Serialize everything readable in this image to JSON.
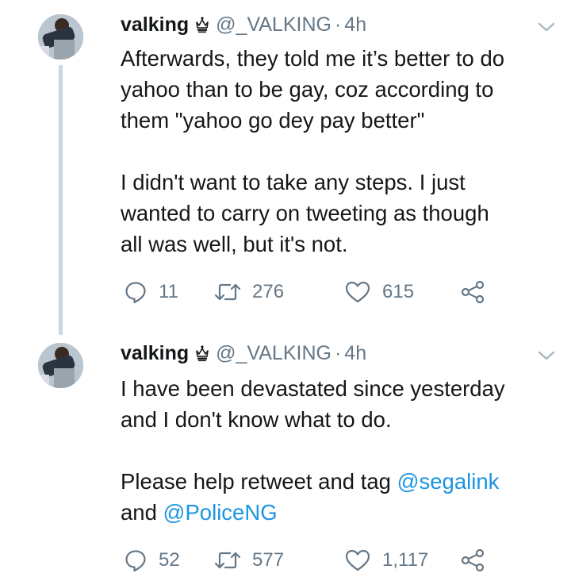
{
  "tweets": [
    {
      "author_name": "valking",
      "verified_badge_icon": "crown-icon",
      "handle": "@_VALKING",
      "separator": "·",
      "time": "4h",
      "lines": [
        "Afterwards, they told me it’s better to do",
        "yahoo than to be gay, coz according to",
        "them \"yahoo go dey pay better\"",
        "",
        "I didn't want to take any steps. I just",
        "wanted to carry on tweeting as though",
        "all was well, but it's not."
      ],
      "replies": "11",
      "retweets": "276",
      "likes": "615"
    },
    {
      "author_name": "valking",
      "verified_badge_icon": "crown-icon",
      "handle": "@_VALKING",
      "separator": "·",
      "time": "4h",
      "line1": "I have been devastated since yesterday",
      "line2": "and I don't know what to do.",
      "line4_prefix": "Please help retweet and tag ",
      "mention1": "@segalink",
      "line5_prefix": "and ",
      "mention2": "@PoliceNG",
      "replies": "52",
      "retweets": "577",
      "likes": "1,117"
    }
  ],
  "colors": {
    "text": "#14171a",
    "secondary": "#657786",
    "mention": "#1b95e0",
    "thread_line": "#ccd6dd"
  }
}
